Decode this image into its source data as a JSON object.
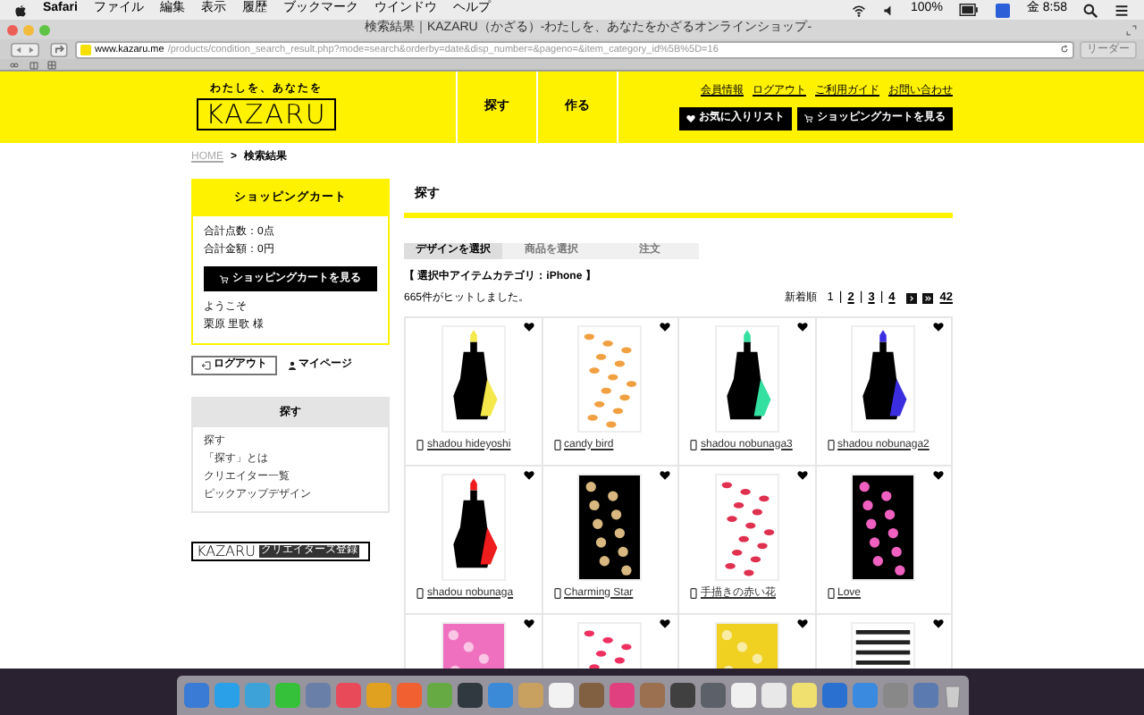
{
  "menubar": {
    "app": "Safari",
    "menus": [
      "ファイル",
      "編集",
      "表示",
      "履歴",
      "ブックマーク",
      "ウインドウ",
      "ヘルプ"
    ],
    "battery": "100%",
    "clock": "金 8:58"
  },
  "window": {
    "title": "検索結果｜KAZARU（かざる）-わたしを、あなたをかざるオンラインショップ-"
  },
  "toolbar": {
    "url_host": "www.kazaru.me",
    "url_path": "/products/condition_search_result.php?mode=search&orderby=date&disp_number=&pageno=&item_category_id%5B%5D=16",
    "reader": "リーダー"
  },
  "site": {
    "logo": {
      "tagline": "わたしを、あなたを",
      "wordmark": "KAZARU"
    },
    "nav": [
      {
        "label": "探す"
      },
      {
        "label": "作る"
      }
    ],
    "top_links": [
      "会員情報",
      "ログアウト",
      "ご利用ガイド",
      "お問い合わせ"
    ],
    "header_buttons": [
      {
        "kind": "favorites",
        "label": "お気に入りリスト"
      },
      {
        "kind": "cart",
        "label": "ショッピングカートを見る"
      }
    ],
    "breadcrumb": [
      "HOME",
      "検索結果"
    ],
    "breadcrumb_separator": ">",
    "page_separator": "|",
    "cart": {
      "title": "ショッピングカート",
      "lines": [
        "合計点数：0点",
        "合計金額：0円"
      ],
      "button": "ショッピングカートを見る",
      "welcome": "ようこそ",
      "user": "栗原 里歌 様"
    },
    "logout": "ログアウト",
    "mypage": "マイページ",
    "search_menu": {
      "title": "探す",
      "items": [
        "探す",
        "「探す」とは",
        "クリエイター一覧",
        "ピックアップデザイン"
      ]
    },
    "creator_banner": {
      "logo": "KAZARU",
      "label": "クリエイターズ登録"
    },
    "heading": "探す",
    "steps": [
      {
        "label": "デザインを選択",
        "selected": true
      },
      {
        "label": "商品を選択",
        "selected": false
      },
      {
        "label": "注文",
        "selected": false
      }
    ],
    "category": "【 選択中アイテムカテゴリ：iPhone 】",
    "result_count": "665件がヒットしました。",
    "sort": "新着順",
    "pages": [
      {
        "label": "1",
        "selected": true
      },
      {
        "label": "2",
        "selected": false
      },
      {
        "label": "3",
        "selected": false
      },
      {
        "label": "4",
        "selected": false
      }
    ],
    "last_page": "42",
    "products": [
      {
        "name": "shadou hideyoshi",
        "kind": "silhouette",
        "color": "#f5e84a"
      },
      {
        "name": "candy bird",
        "kind": "light-pattern",
        "color": "#f0a040"
      },
      {
        "name": "shadou nobunaga3",
        "kind": "silhouette",
        "color": "#33e0a0"
      },
      {
        "name": "shadou nobunaga2",
        "kind": "silhouette",
        "color": "#3a2ee0"
      },
      {
        "name": "shadou nobunaga",
        "kind": "silhouette",
        "color": "#ee1c1c"
      },
      {
        "name": "Charming Star",
        "kind": "dark-pattern",
        "color": "#d8b880"
      },
      {
        "name": "手描きの赤い花",
        "kind": "light-pattern",
        "color": "#e03050"
      },
      {
        "name": "Love",
        "kind": "dark-pattern",
        "color": "#f060c0"
      },
      {
        "kind": "solid-pattern",
        "color": "#f070c0"
      },
      {
        "kind": "light-pattern",
        "color": "#f03060"
      },
      {
        "kind": "solid-pattern",
        "color": "#f0d020"
      },
      {
        "kind": "stripe-pattern",
        "color": "#222222"
      }
    ]
  }
}
